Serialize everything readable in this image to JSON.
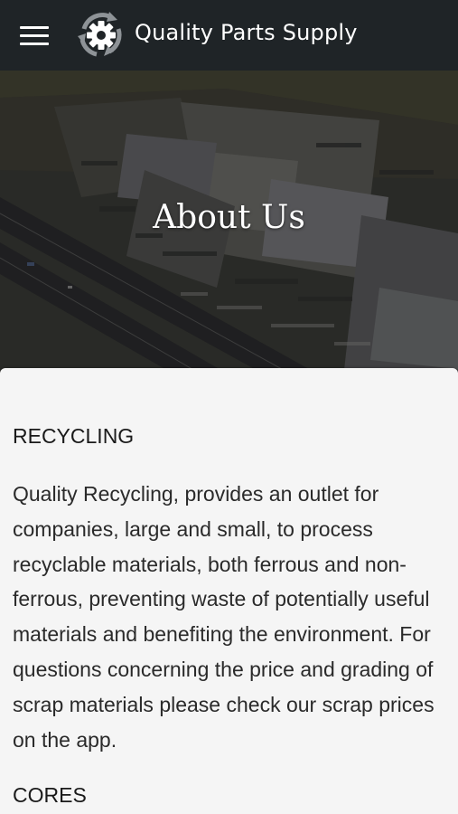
{
  "app_bar": {
    "brand_name": "Quality Parts Supply",
    "menu_icon": "hamburger-menu-icon",
    "logo_icon": "gear-recycle-icon",
    "background_color": "#1f2427"
  },
  "hero": {
    "title": "About Us"
  },
  "content": {
    "sections": [
      {
        "heading": "RECYCLING",
        "body": "Quality Recycling, provides an outlet for companies, large and small, to process recyclable materials, both ferrous and non-ferrous, preventing waste of potentially useful materials and benefiting the environment. For questions concerning the price and grading of scrap materials please check our scrap prices on the app."
      },
      {
        "heading": "CORES"
      }
    ]
  }
}
